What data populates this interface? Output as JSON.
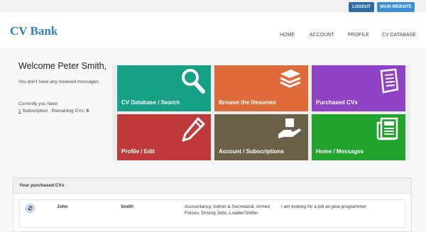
{
  "topbar": {
    "logout_label": "LOGOUT",
    "main_website_label": "MAIN WEBSITE"
  },
  "header": {
    "logo": "CV Bank",
    "nav": [
      "HOME",
      "ACCOUNT",
      "PROFILE",
      "CV DATABASE"
    ]
  },
  "welcome": {
    "title": "Welcome Peter Smith,",
    "messages_note": "You don't have any received messages.",
    "subscription_intro": "Currently you have:",
    "subscription_count": "1",
    "subscription_word": "Subscription",
    "remaining_label": ", Remaining CVs:",
    "remaining_value": "9"
  },
  "tiles": [
    {
      "label": "CV Database / Search",
      "icon": "search-icon",
      "color": "#16a085"
    },
    {
      "label": "Browse the Resumes",
      "icon": "stack-icon",
      "color": "#e06b3a"
    },
    {
      "label": "Purchased CVs",
      "icon": "document-icon",
      "color": "#8e44c4"
    },
    {
      "label": "Profile / Edit",
      "icon": "pencil-icon",
      "color": "#c0393b"
    },
    {
      "label": "Account / Subscriptions",
      "icon": "hand-box-icon",
      "color": "#6b6148"
    },
    {
      "label": "Home / Messages",
      "icon": "newspaper-icon",
      "color": "#21a32d"
    }
  ],
  "purchased": {
    "title": "Your purchased CVs",
    "rows": [
      {
        "first_name": "John",
        "last_name": "Smith",
        "categories": "Accountancy, Admin & Secretarial, Armed Forces, Driving Jobs, Loader/Shifter",
        "description": "I am looking for a job as java programmer"
      }
    ]
  }
}
